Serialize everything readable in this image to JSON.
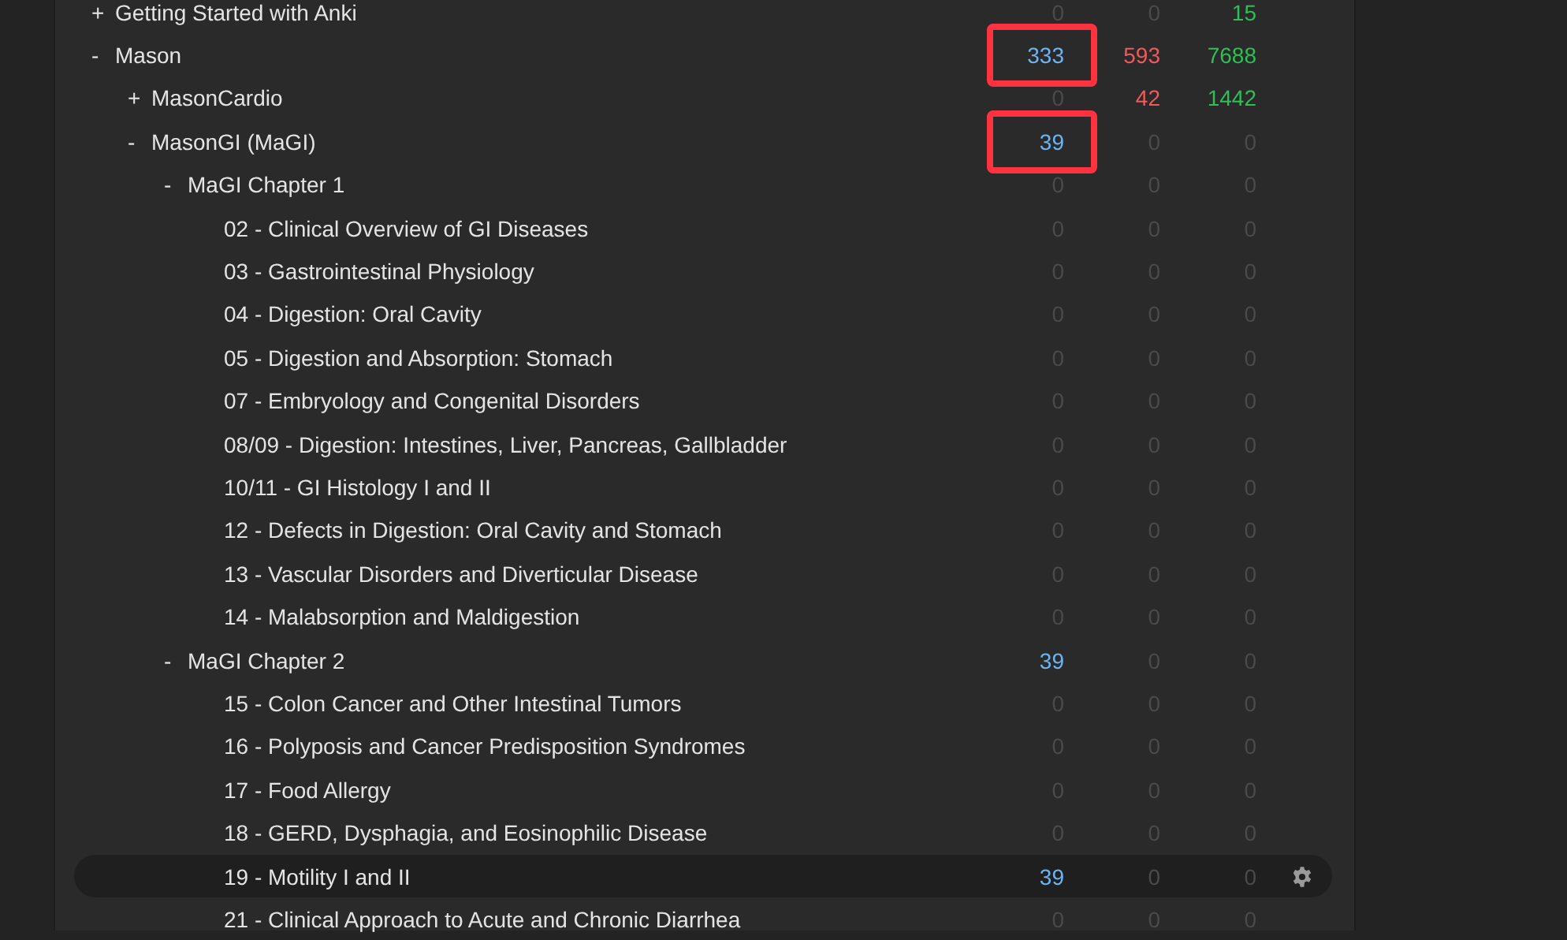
{
  "decks": [
    {
      "expander": "+",
      "name": "Getting Started with Anki",
      "counts": [
        "0",
        "0",
        "15"
      ],
      "lit": [
        false,
        false,
        true
      ],
      "boxed": [
        false,
        false,
        false
      ],
      "selected": false
    },
    {
      "expander": "-",
      "name": "Mason",
      "counts": [
        "333",
        "593",
        "7688"
      ],
      "lit": [
        true,
        true,
        true
      ],
      "boxed": [
        true,
        false,
        false
      ],
      "selected": false,
      "children": [
        {
          "expander": "+",
          "name": "MasonCardio",
          "counts": [
            "0",
            "42",
            "1442"
          ],
          "lit": [
            false,
            true,
            true
          ],
          "boxed": [
            false,
            false,
            false
          ],
          "selected": false
        },
        {
          "expander": "-",
          "name": "MasonGI (MaGI)",
          "counts": [
            "39",
            "0",
            "0"
          ],
          "lit": [
            true,
            false,
            false
          ],
          "boxed": [
            true,
            false,
            false
          ],
          "selected": false,
          "children": [
            {
              "expander": "-",
              "name": "MaGI Chapter 1",
              "counts": [
                "0",
                "0",
                "0"
              ],
              "lit": [
                false,
                false,
                false
              ],
              "boxed": [
                false,
                false,
                false
              ],
              "selected": false,
              "children": [
                {
                  "name": "02 - Clinical Overview of GI Diseases",
                  "counts": [
                    "0",
                    "0",
                    "0"
                  ],
                  "lit": [
                    false,
                    false,
                    false
                  ],
                  "boxed": [
                    false,
                    false,
                    false
                  ],
                  "selected": false
                },
                {
                  "name": "03 - Gastrointestinal Physiology",
                  "counts": [
                    "0",
                    "0",
                    "0"
                  ],
                  "lit": [
                    false,
                    false,
                    false
                  ],
                  "boxed": [
                    false,
                    false,
                    false
                  ],
                  "selected": false
                },
                {
                  "name": "04 - Digestion: Oral Cavity",
                  "counts": [
                    "0",
                    "0",
                    "0"
                  ],
                  "lit": [
                    false,
                    false,
                    false
                  ],
                  "boxed": [
                    false,
                    false,
                    false
                  ],
                  "selected": false
                },
                {
                  "name": "05 - Digestion and Absorption: Stomach",
                  "counts": [
                    "0",
                    "0",
                    "0"
                  ],
                  "lit": [
                    false,
                    false,
                    false
                  ],
                  "boxed": [
                    false,
                    false,
                    false
                  ],
                  "selected": false
                },
                {
                  "name": "07 - Embryology and Congenital Disorders",
                  "counts": [
                    "0",
                    "0",
                    "0"
                  ],
                  "lit": [
                    false,
                    false,
                    false
                  ],
                  "boxed": [
                    false,
                    false,
                    false
                  ],
                  "selected": false
                },
                {
                  "name": "08/09 - Digestion: Intestines, Liver, Pancreas, Gallbladder",
                  "counts": [
                    "0",
                    "0",
                    "0"
                  ],
                  "lit": [
                    false,
                    false,
                    false
                  ],
                  "boxed": [
                    false,
                    false,
                    false
                  ],
                  "selected": false
                },
                {
                  "name": "10/11 - GI Histology I and II",
                  "counts": [
                    "0",
                    "0",
                    "0"
                  ],
                  "lit": [
                    false,
                    false,
                    false
                  ],
                  "boxed": [
                    false,
                    false,
                    false
                  ],
                  "selected": false
                },
                {
                  "name": "12 - Defects in Digestion: Oral Cavity and Stomach",
                  "counts": [
                    "0",
                    "0",
                    "0"
                  ],
                  "lit": [
                    false,
                    false,
                    false
                  ],
                  "boxed": [
                    false,
                    false,
                    false
                  ],
                  "selected": false
                },
                {
                  "name": "13 - Vascular Disorders and Diverticular Disease",
                  "counts": [
                    "0",
                    "0",
                    "0"
                  ],
                  "lit": [
                    false,
                    false,
                    false
                  ],
                  "boxed": [
                    false,
                    false,
                    false
                  ],
                  "selected": false
                },
                {
                  "name": "14 - Malabsorption and Maldigestion",
                  "counts": [
                    "0",
                    "0",
                    "0"
                  ],
                  "lit": [
                    false,
                    false,
                    false
                  ],
                  "boxed": [
                    false,
                    false,
                    false
                  ],
                  "selected": false
                }
              ]
            },
            {
              "expander": "-",
              "name": "MaGI Chapter 2",
              "counts": [
                "39",
                "0",
                "0"
              ],
              "lit": [
                true,
                false,
                false
              ],
              "boxed": [
                false,
                false,
                false
              ],
              "selected": false,
              "children": [
                {
                  "name": "15 - Colon Cancer and Other Intestinal Tumors",
                  "counts": [
                    "0",
                    "0",
                    "0"
                  ],
                  "lit": [
                    false,
                    false,
                    false
                  ],
                  "boxed": [
                    false,
                    false,
                    false
                  ],
                  "selected": false
                },
                {
                  "name": "16 - Polyposis and Cancer Predisposition Syndromes",
                  "counts": [
                    "0",
                    "0",
                    "0"
                  ],
                  "lit": [
                    false,
                    false,
                    false
                  ],
                  "boxed": [
                    false,
                    false,
                    false
                  ],
                  "selected": false
                },
                {
                  "name": "17 - Food Allergy",
                  "counts": [
                    "0",
                    "0",
                    "0"
                  ],
                  "lit": [
                    false,
                    false,
                    false
                  ],
                  "boxed": [
                    false,
                    false,
                    false
                  ],
                  "selected": false
                },
                {
                  "name": "18 - GERD, Dysphagia, and Eosinophilic Disease",
                  "counts": [
                    "0",
                    "0",
                    "0"
                  ],
                  "lit": [
                    false,
                    false,
                    false
                  ],
                  "boxed": [
                    false,
                    false,
                    false
                  ],
                  "selected": false
                },
                {
                  "name": "19 - Motility I and II",
                  "counts": [
                    "39",
                    "0",
                    "0"
                  ],
                  "lit": [
                    true,
                    false,
                    false
                  ],
                  "boxed": [
                    false,
                    false,
                    false
                  ],
                  "selected": true
                },
                {
                  "name": "21 - Clinical Approach to Acute and Chronic Diarrhea",
                  "counts": [
                    "0",
                    "0",
                    "0"
                  ],
                  "lit": [
                    false,
                    false,
                    false
                  ],
                  "boxed": [
                    false,
                    false,
                    false
                  ],
                  "selected": false
                }
              ]
            }
          ]
        }
      ]
    }
  ]
}
